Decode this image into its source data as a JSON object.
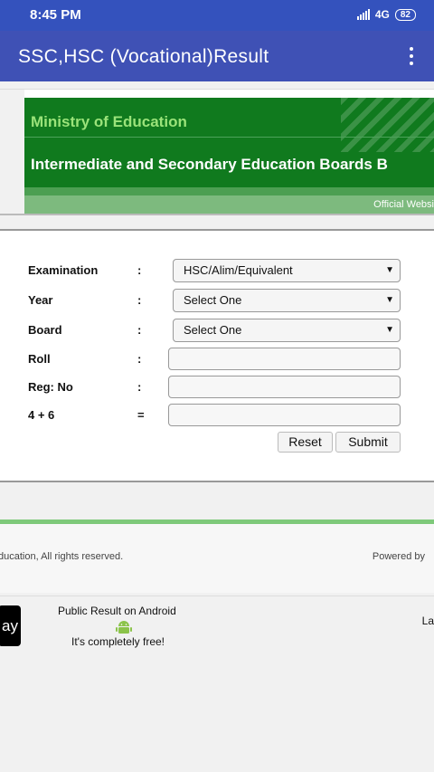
{
  "status_bar": {
    "time": "8:45 PM",
    "network": "4G",
    "battery": "82"
  },
  "app_bar": {
    "title": "SSC,HSC (Vocational)Result"
  },
  "banner": {
    "ministry": "Ministry of Education",
    "boards": "Intermediate and Secondary Education Boards B",
    "official": "Official Websi"
  },
  "form": {
    "colon": ":",
    "equals": "=",
    "examination": {
      "label": "Examination",
      "value": "HSC/Alim/Equivalent"
    },
    "year": {
      "label": "Year",
      "value": "Select One"
    },
    "board": {
      "label": "Board",
      "value": "Select One"
    },
    "roll": {
      "label": "Roll",
      "value": ""
    },
    "reg_no": {
      "label": "Reg: No",
      "value": ""
    },
    "captcha": {
      "label": "4 + 6",
      "value": ""
    },
    "reset_label": "Reset",
    "submit_label": "Submit"
  },
  "footer": {
    "copyright": "ducation, All rights reserved.",
    "powered_by": "Powered by"
  },
  "promo": {
    "badge": "ay",
    "title": "Public Result on Android",
    "free": "It's completely free!",
    "right": "La"
  },
  "colors": {
    "status_bar": "#3452bd",
    "app_bar": "#3f51b5",
    "banner": "#107a1e",
    "ministry_text": "#9be37a"
  }
}
